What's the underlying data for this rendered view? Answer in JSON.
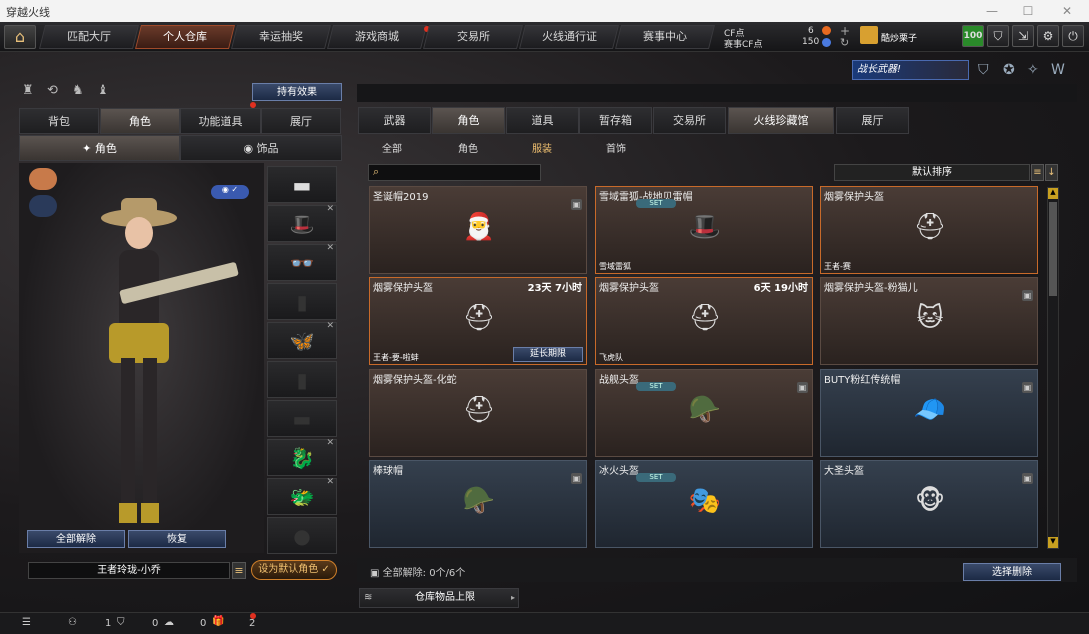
{
  "window": {
    "title": "穿越火线"
  },
  "nav": {
    "tabs": [
      "匹配大厅",
      "个人仓库",
      "幸运抽奖",
      "游戏商城",
      "交易所",
      "火线通行证",
      "赛事中心"
    ],
    "active": "个人仓库"
  },
  "currency": {
    "cf_label": "CF点",
    "cf_value": "6",
    "match_label": "赛事CF点",
    "match_value": "150"
  },
  "user": {
    "name": "酷炒栗子",
    "level": "100"
  },
  "left": {
    "owned_effects": "持有效果",
    "tabs": [
      "背包",
      "角色",
      "功能道具",
      "展厅"
    ],
    "subtabs": [
      "角色",
      "饰品"
    ],
    "unequip_all": "全部解除",
    "restore": "恢复",
    "character_name": "王者玲珑-小乔",
    "set_default": "设为默认角色"
  },
  "right": {
    "promo": "战长武器!",
    "tabs": [
      "武器",
      "角色",
      "道具",
      "暂存箱",
      "交易所",
      "火线珍藏馆",
      "展厅"
    ],
    "filters": [
      "全部",
      "角色",
      "服装",
      "首饰"
    ],
    "active_filter": "服装",
    "sort": "默认排序",
    "search_placeholder": "",
    "items": [
      {
        "name": "圣诞帽2019",
        "time": "",
        "tag": "",
        "set": "",
        "lock": true,
        "icon": "santa-hat-icon",
        "glyph": "🎅",
        "sel": false,
        "blue": false,
        "extend": ""
      },
      {
        "name": "雪域雷狐-战地贝雷帽",
        "time": "",
        "tag": "雪域雷狐",
        "set": "SET",
        "lock": false,
        "icon": "beret-icon",
        "glyph": "🎩",
        "sel": true,
        "blue": false,
        "extend": ""
      },
      {
        "name": "烟雾保护头盔",
        "time": "",
        "tag": "王者-赛",
        "set": "",
        "lock": false,
        "icon": "helmet-icon",
        "glyph": "⛑",
        "sel": true,
        "blue": false,
        "extend": ""
      },
      {
        "name": "烟雾保护头盔",
        "time": "23天 7小时",
        "tag": "王者-要-啦蚌",
        "set": "",
        "lock": false,
        "icon": "helmet-icon",
        "glyph": "⛑",
        "sel": true,
        "blue": false,
        "extend": "延长期限"
      },
      {
        "name": "烟雾保护头盔",
        "time": "6天 19小时",
        "tag": "飞虎队",
        "set": "",
        "lock": false,
        "icon": "helmet-icon",
        "glyph": "⛑",
        "sel": true,
        "blue": false,
        "extend": ""
      },
      {
        "name": "烟雾保护头盔-粉猫儿",
        "time": "",
        "tag": "",
        "set": "",
        "lock": true,
        "icon": "pink-helmet-icon",
        "glyph": "🐱",
        "sel": false,
        "blue": false,
        "extend": ""
      },
      {
        "name": "烟雾保护头盔-化蛇",
        "time": "",
        "tag": "",
        "set": "",
        "lock": false,
        "icon": "helmet-icon",
        "glyph": "⛑",
        "sel": false,
        "blue": false,
        "extend": ""
      },
      {
        "name": "战舰头盔",
        "time": "",
        "tag": "",
        "set": "SET",
        "lock": true,
        "icon": "warship-helmet-icon",
        "glyph": "🪖",
        "sel": false,
        "blue": false,
        "extend": ""
      },
      {
        "name": "BUTY粉红传统帽",
        "time": "",
        "tag": "",
        "set": "",
        "lock": true,
        "icon": "pink-cap-icon",
        "glyph": "🧢",
        "sel": false,
        "blue": true,
        "extend": ""
      },
      {
        "name": "棒球帽",
        "time": "",
        "tag": "",
        "set": "",
        "lock": true,
        "icon": "baseball-cap-icon",
        "glyph": "🪖",
        "sel": false,
        "blue": true,
        "extend": ""
      },
      {
        "name": "冰火头盔",
        "time": "",
        "tag": "",
        "set": "SET",
        "lock": false,
        "icon": "ice-fire-helmet-icon",
        "glyph": "🎭",
        "sel": false,
        "blue": true,
        "extend": ""
      },
      {
        "name": "大圣头盔",
        "time": "",
        "tag": "",
        "set": "",
        "lock": true,
        "icon": "monkey-king-icon",
        "glyph": "🐵",
        "sel": false,
        "blue": true,
        "extend": ""
      }
    ],
    "release_all": "全部解除:",
    "release_count": "0个/6个",
    "select_delete": "选择删除",
    "storage_limit": "仓库物品上限"
  },
  "statusbar": {
    "count1": "1",
    "count2": "0",
    "count3": "0",
    "count4": "2"
  }
}
